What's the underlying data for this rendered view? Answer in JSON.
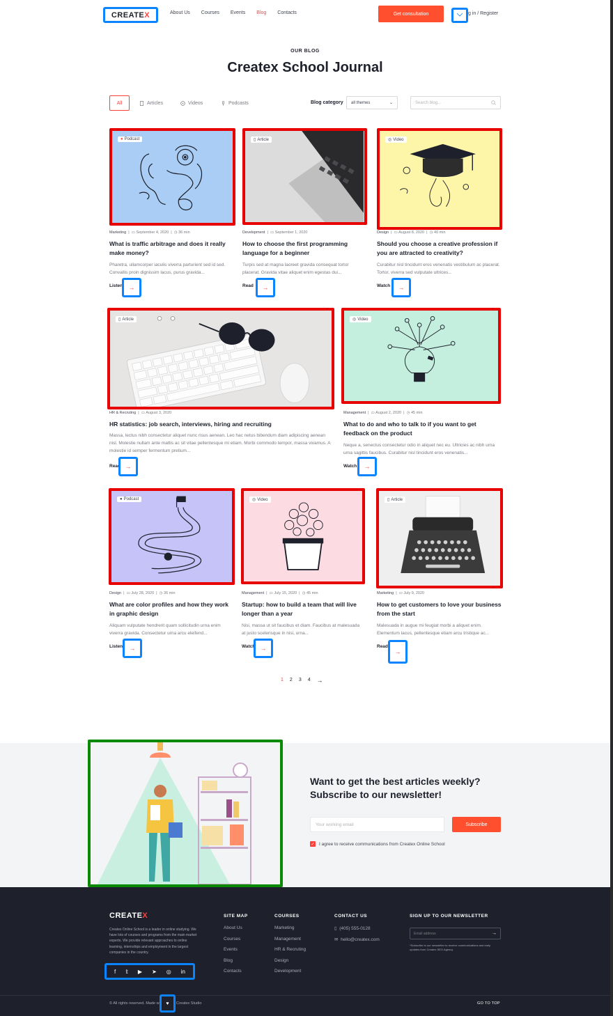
{
  "header": {
    "logo_text": "CREATE",
    "logo_accent": "X",
    "nav": [
      "About Us",
      "Courses",
      "Events",
      "Blog",
      "Contacts"
    ],
    "active_nav": "Blog",
    "cta_label": "Get consultation",
    "login_label": "Log in / Register",
    "login_visible": "g in / Register"
  },
  "hero": {
    "eyebrow": "OUR BLOG",
    "title": "Createx School Journal"
  },
  "filters": {
    "all": "All",
    "articles": "Articles",
    "videos": "Videos",
    "podcasts": "Podcasts",
    "category_label": "Blog category",
    "category_value": "all themes",
    "search_placeholder": "Search blog..."
  },
  "posts": [
    {
      "type": "Podcast",
      "category": "Marketing",
      "date": "September 4, 2020",
      "duration": "36 min",
      "title": "What is traffic arbitrage and does it really make money?",
      "excerpt": "Pharetra, ullamcorper iaculis viverra parturient sed id sed. Convallis proin dignissim lacus, purus gravida...",
      "action": "Listen",
      "bg": "#a9cdf4"
    },
    {
      "type": "Article",
      "category": "Development",
      "date": "September 1, 2020",
      "duration": "",
      "title": "How to choose the first programming language for a beginner",
      "excerpt": "Turpis sed at magna laoreet gravida consequat tortor placerat. Gravida vitae aliquet enim egestas dui...",
      "action": "Read",
      "bg": "#d9d9d9"
    },
    {
      "type": "Video",
      "category": "Design",
      "date": "August 8, 2020",
      "duration": "40 min",
      "title": "Should you choose a creative profession if you are attracted to creativity?",
      "excerpt": "Curabitur nisl tincidunt eros venenatis vestibulum ac placerat. Tortor, viverra sed vulputate ultrices...",
      "action": "Watch",
      "bg": "#fdf5a8"
    },
    {
      "type": "Article",
      "category": "HR & Recruting",
      "date": "August 3, 2020",
      "duration": "",
      "title": "HR statistics: job search,  interviews, hiring and recruiting",
      "excerpt": "Massa, lectus nibh consectetur aliquet nunc risus aenean. Leo hac netus bibendum diam adipiscing aenean nisl. Molestie nullam ante mattis ac sit vitae pellentesque mi etiam. Morbi commodo tempor, massa vivamus. A molestie id semper fermentum pretium...",
      "action": "Read",
      "bg": "#e5e4e2"
    },
    {
      "type": "Video",
      "category": "Management",
      "date": "August 2, 2020",
      "duration": "45 min",
      "title": "What to do and who to talk to if you want to get feedback on the product",
      "excerpt": "Neque a, senectus consectetur odio in aliquet nec eu. Ultricies ac nibh urna urna sagittis faucibus. Curabitur nisl tincidunt eros venenatis...",
      "action": "Watch",
      "bg": "#c4eedd"
    },
    {
      "type": "Podcast",
      "category": "Design",
      "date": "July 28, 2020",
      "duration": "36 min",
      "title": "What are color profiles and how they work in graphic design",
      "excerpt": "Aliquam vulputate hendrerit quam sollicitudin urna enim viverra gravida. Consectetur urna arcu eleifend...",
      "action": "Listen",
      "bg": "#c5c3f8"
    },
    {
      "type": "Video",
      "category": "Management",
      "date": "July 15, 2020",
      "duration": "45 min",
      "title": "Startup: how to build a team that will live longer than a year",
      "excerpt": "Nisi, massa ut sit faucibus et diam. Faucibus at malesuada at justo scelerisque in nisi, urna...",
      "action": "Watch",
      "bg": "#fcdbe2"
    },
    {
      "type": "Article",
      "category": "Marketing",
      "date": "July 9, 2020",
      "duration": "",
      "title": "How to get customers to love your business from the start",
      "excerpt": "Malesuada in augue mi feugiat morbi a aliquet enim. Elementum lacus, pellentesque etiam arcu tristique ac...",
      "action": "Read",
      "bg": "#f0f0f0"
    }
  ],
  "pagination": {
    "pages": [
      "1",
      "2",
      "3",
      "4"
    ],
    "current": "1",
    "next": "→"
  },
  "newsletter": {
    "title": "Want to get the best articles weekly? Subscribe to our newsletter!",
    "input_placeholder": "Your working email",
    "button": "Subscribe",
    "agree": "I agree to receive communications from Createx Online School"
  },
  "footer": {
    "logo_text": "CREATE",
    "logo_accent": "X",
    "description": "Createx Online School is a leader in online studying. We have lots of courses and programs from the main market experts. We provide relevant approaches to online learning, internships and employment in the largest companies in the country.",
    "site_map_title": "SITE MAP",
    "site_map": [
      "About Us",
      "Courses",
      "Events",
      "Blog",
      "Contacts"
    ],
    "courses_title": "COURSES",
    "courses": [
      "Marketing",
      "Management",
      "HR & Recruting",
      "Design",
      "Development"
    ],
    "contact_title": "CONTACT US",
    "phone": "(405) 555-0128",
    "email": "hello@createx.com",
    "newsletter_title": "SIGN UP TO OUR NEWSLETTER",
    "email_placeholder": "Email address",
    "newsletter_note": "*Subscribe to our newsletter to receive communications and early updates from Createx SEO Agency.",
    "copyright": "© All rights reserved. Made w",
    "studio": "Createx Studio",
    "go_top": "GO TO TOP"
  },
  "colors": {
    "accent": "#ff3f3a",
    "cta": "#ff4f2e",
    "dark": "#1e212c",
    "highlight_blue": "#0a84ff",
    "highlight_red": "#e80000",
    "highlight_green": "#0a8a00"
  }
}
